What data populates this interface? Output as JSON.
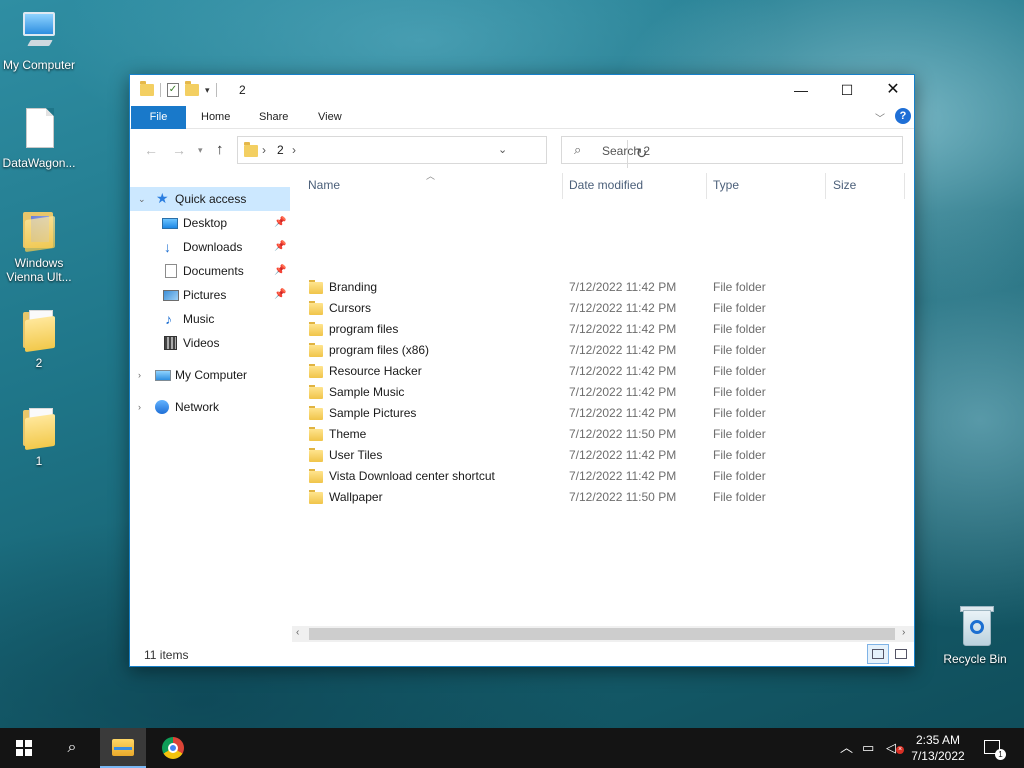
{
  "desktop": {
    "icons": [
      {
        "label": "My Computer"
      },
      {
        "label": "DataWagon..."
      },
      {
        "label": "Windows Vienna Ult..."
      },
      {
        "label": "2"
      },
      {
        "label": "1"
      },
      {
        "label": "Recycle Bin"
      }
    ]
  },
  "window": {
    "title": "2",
    "ribbon_tabs": [
      "File",
      "Home",
      "Share",
      "View"
    ],
    "address": {
      "crumb": "2",
      "sep": "›"
    },
    "search_placeholder": "Search 2",
    "columns": [
      "Name",
      "Date modified",
      "Type",
      "Size"
    ],
    "sidebar": [
      {
        "label": "Quick access"
      },
      {
        "label": "Desktop"
      },
      {
        "label": "Downloads"
      },
      {
        "label": "Documents"
      },
      {
        "label": "Pictures"
      },
      {
        "label": "Music"
      },
      {
        "label": "Videos"
      },
      {
        "label": "My Computer"
      },
      {
        "label": "Network"
      }
    ],
    "files": [
      {
        "name": "Branding",
        "date": "7/12/2022 11:42 PM",
        "type": "File folder"
      },
      {
        "name": "Cursors",
        "date": "7/12/2022 11:42 PM",
        "type": "File folder"
      },
      {
        "name": "program files",
        "date": "7/12/2022 11:42 PM",
        "type": "File folder"
      },
      {
        "name": "program files (x86)",
        "date": "7/12/2022 11:42 PM",
        "type": "File folder"
      },
      {
        "name": "Resource Hacker",
        "date": "7/12/2022 11:42 PM",
        "type": "File folder"
      },
      {
        "name": "Sample Music",
        "date": "7/12/2022 11:42 PM",
        "type": "File folder"
      },
      {
        "name": "Sample Pictures",
        "date": "7/12/2022 11:42 PM",
        "type": "File folder"
      },
      {
        "name": "Theme",
        "date": "7/12/2022 11:50 PM",
        "type": "File folder"
      },
      {
        "name": "User Tiles",
        "date": "7/12/2022 11:42 PM",
        "type": "File folder"
      },
      {
        "name": "Vista Download center shortcut",
        "date": "7/12/2022 11:42 PM",
        "type": "File folder"
      },
      {
        "name": "Wallpaper",
        "date": "7/12/2022 11:50 PM",
        "type": "File folder"
      }
    ],
    "status": "11 items"
  },
  "taskbar": {
    "time": "2:35 AM",
    "date": "7/13/2022",
    "notification_count": "1"
  },
  "icons": {
    "minimize": "minimize-icon",
    "maximize": "maximize-icon",
    "close": "close-icon",
    "help": "help-icon",
    "search": "search-icon",
    "refresh": "refresh-icon",
    "windows": "windows-logo-icon",
    "chrome": "chrome-icon",
    "explorer": "file-explorer-icon"
  },
  "colors": {
    "accent": "#1979ca",
    "selection": "#cce8ff",
    "taskbar": "#141414"
  }
}
